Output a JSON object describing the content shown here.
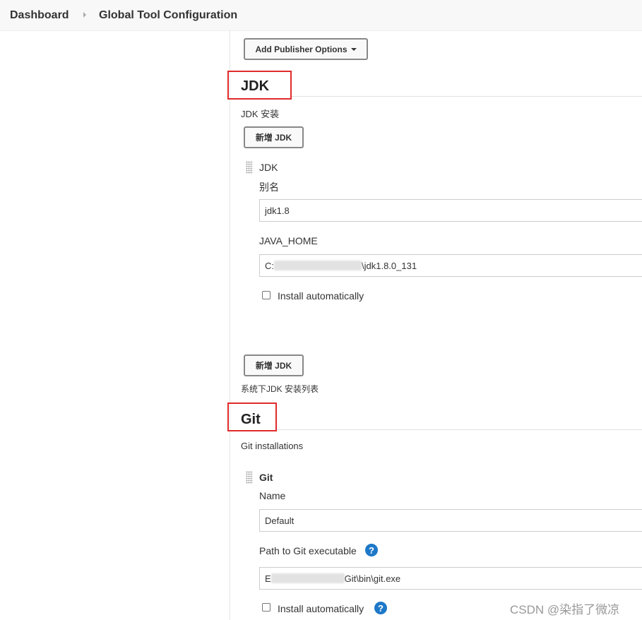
{
  "breadcrumb": {
    "home": "Dashboard",
    "current": "Global Tool Configuration"
  },
  "publisher_button": "Add Publisher Options",
  "jdk": {
    "section_title": "JDK",
    "installations_label": "JDK 安装",
    "add_button_top": "新增 JDK",
    "item_header": "JDK",
    "alias_label": "别名",
    "alias_value": "jdk1.8",
    "java_home_label": "JAVA_HOME",
    "java_home_prefix": "C:",
    "java_home_suffix": "\\jdk1.8.0_131",
    "install_auto_label": "Install automatically",
    "add_button_bottom": "新增 JDK",
    "list_hint": "系统下JDK 安装列表"
  },
  "git": {
    "section_title": "Git",
    "installations_label": "Git installations",
    "item_header": "Git",
    "name_label": "Name",
    "name_value": "Default",
    "path_label": "Path to Git executable",
    "path_prefix": "E",
    "path_suffix": "Git\\bin\\git.exe",
    "install_auto_label": "Install automatically",
    "help_glyph": "?"
  },
  "watermark": "CSDN @染指了微凉",
  "colors": {
    "highlight_box": "#e02b2b",
    "help_icon": "#1e78c8"
  }
}
